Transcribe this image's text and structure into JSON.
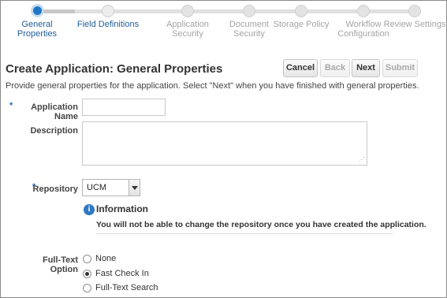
{
  "train": {
    "steps": [
      {
        "label": "General Properties",
        "state": "current"
      },
      {
        "label": "Field Definitions",
        "state": "enabled"
      },
      {
        "label": "Application Security",
        "state": "disabled"
      },
      {
        "label": "Document Security",
        "state": "disabled"
      },
      {
        "label": "Storage Policy",
        "state": "disabled"
      },
      {
        "label_line1": "Workflow",
        "label_line2": "Configuration",
        "state": "disabled"
      },
      {
        "label": "Review Settings",
        "state": "disabled"
      }
    ]
  },
  "header": {
    "title": "Create Application: General Properties",
    "buttons": {
      "cancel": "Cancel",
      "back": "Back",
      "next": "Next",
      "submit": "Submit"
    },
    "instructions": "Provide general properties for the application. Select \"Next\" when you have finished with general properties."
  },
  "form": {
    "required_marker": "*",
    "application_name": {
      "label": "Application Name",
      "value": ""
    },
    "description": {
      "label": "Description",
      "value": ""
    },
    "repository": {
      "label": "Repository",
      "selected": "UCM"
    },
    "information": {
      "icon_glyph": "i",
      "title": "Information",
      "text": "You will not be able to change the repository once you have created the application."
    },
    "full_text_option": {
      "label": "Full-Text Option",
      "options": [
        "None",
        "Fast Check In",
        "Full-Text Search"
      ],
      "selected": "Fast Check In"
    },
    "resize_grip_glyph": "⋰"
  },
  "colors": {
    "accent": "#1f76c7",
    "link": "#1f5f99",
    "required": "#1f6db9"
  }
}
